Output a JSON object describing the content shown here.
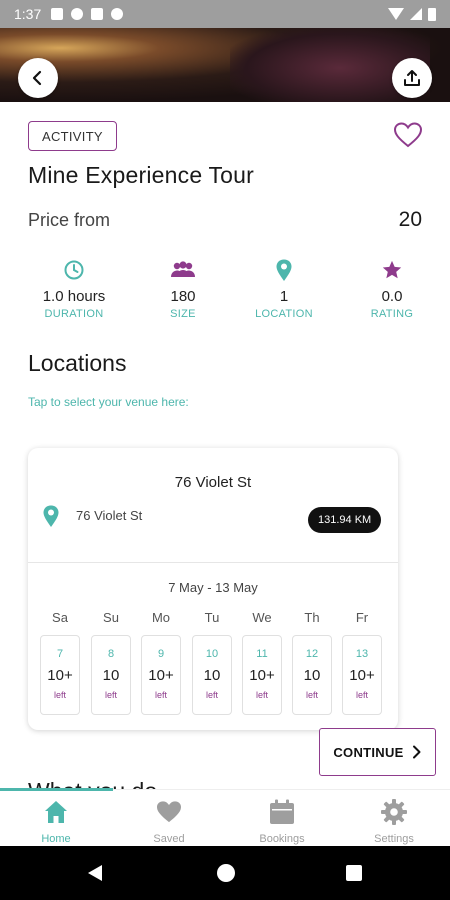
{
  "status_bar": {
    "time": "1:37"
  },
  "header": {
    "badge": "ACTIVITY",
    "title": "Mine Experience Tour",
    "price_label": "Price from",
    "price_value": "20"
  },
  "stats": [
    {
      "icon": "clock-icon",
      "value": "1.0 hours",
      "label": "DURATION"
    },
    {
      "icon": "group-icon",
      "value": "180",
      "label": "SIZE"
    },
    {
      "icon": "location-pin-icon",
      "value": "1",
      "label": "LOCATION"
    },
    {
      "icon": "star-icon",
      "value": "0.0",
      "label": "RATING"
    }
  ],
  "locations": {
    "title": "Locations",
    "hint": "Tap to select your venue here:",
    "venue": {
      "name": "76 Violet St",
      "address": "76 Violet St",
      "distance": "131.94 KM"
    },
    "date_range": "7 May - 13 May",
    "days": [
      {
        "dow": "Sa",
        "date": "7",
        "avail": "10+",
        "left": "left"
      },
      {
        "dow": "Su",
        "date": "8",
        "avail": "10",
        "left": "left"
      },
      {
        "dow": "Mo",
        "date": "9",
        "avail": "10+",
        "left": "left"
      },
      {
        "dow": "Tu",
        "date": "10",
        "avail": "10",
        "left": "left"
      },
      {
        "dow": "We",
        "date": "11",
        "avail": "10+",
        "left": "left"
      },
      {
        "dow": "Th",
        "date": "12",
        "avail": "10",
        "left": "left"
      },
      {
        "dow": "Fr",
        "date": "13",
        "avail": "10+",
        "left": "left"
      }
    ]
  },
  "continue_label": "CONTINUE",
  "partial_heading": "What you do",
  "bottom_nav": [
    {
      "label": "Home",
      "icon": "home-icon",
      "active": true
    },
    {
      "label": "Saved",
      "icon": "heart-icon",
      "active": false
    },
    {
      "label": "Bookings",
      "icon": "calendar-icon",
      "active": false
    },
    {
      "label": "Settings",
      "icon": "gear-icon",
      "active": false
    }
  ],
  "colors": {
    "accent": "#4db6ac",
    "brand_purple": "#8e3b8c"
  }
}
